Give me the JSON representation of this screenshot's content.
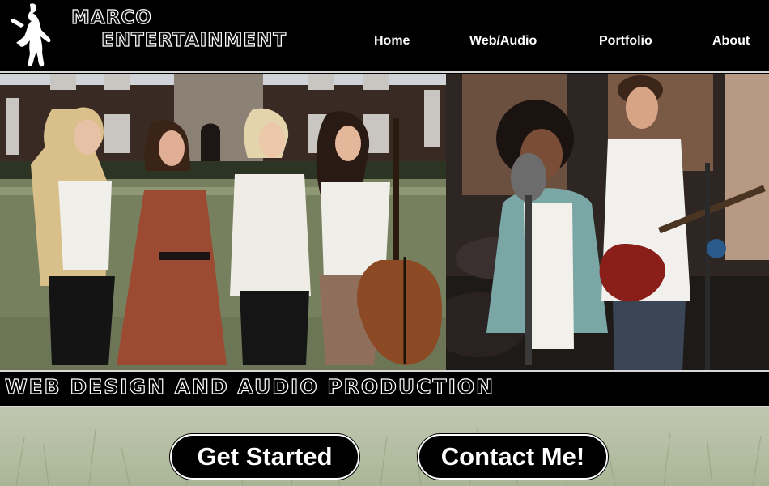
{
  "brand": {
    "line1": "MARCO",
    "line2": "ENTERTAINMENT",
    "logo_icon": "dancer-silhouette-icon"
  },
  "nav": {
    "items": [
      "Home",
      "Web/Audio",
      "Portfolio",
      "About"
    ]
  },
  "hero": {
    "left_image": "string-quartet-photo",
    "right_image": "recording-studio-photo"
  },
  "tagline": "WEB DESIGN AND AUDIO PRODUCTION",
  "cta": {
    "get_started": "Get Started",
    "contact": "Contact Me!"
  },
  "colors": {
    "background": "#000000",
    "text": "#ffffff",
    "footer_grass": "#b7c0a5",
    "rule": "#d8d8d8"
  }
}
